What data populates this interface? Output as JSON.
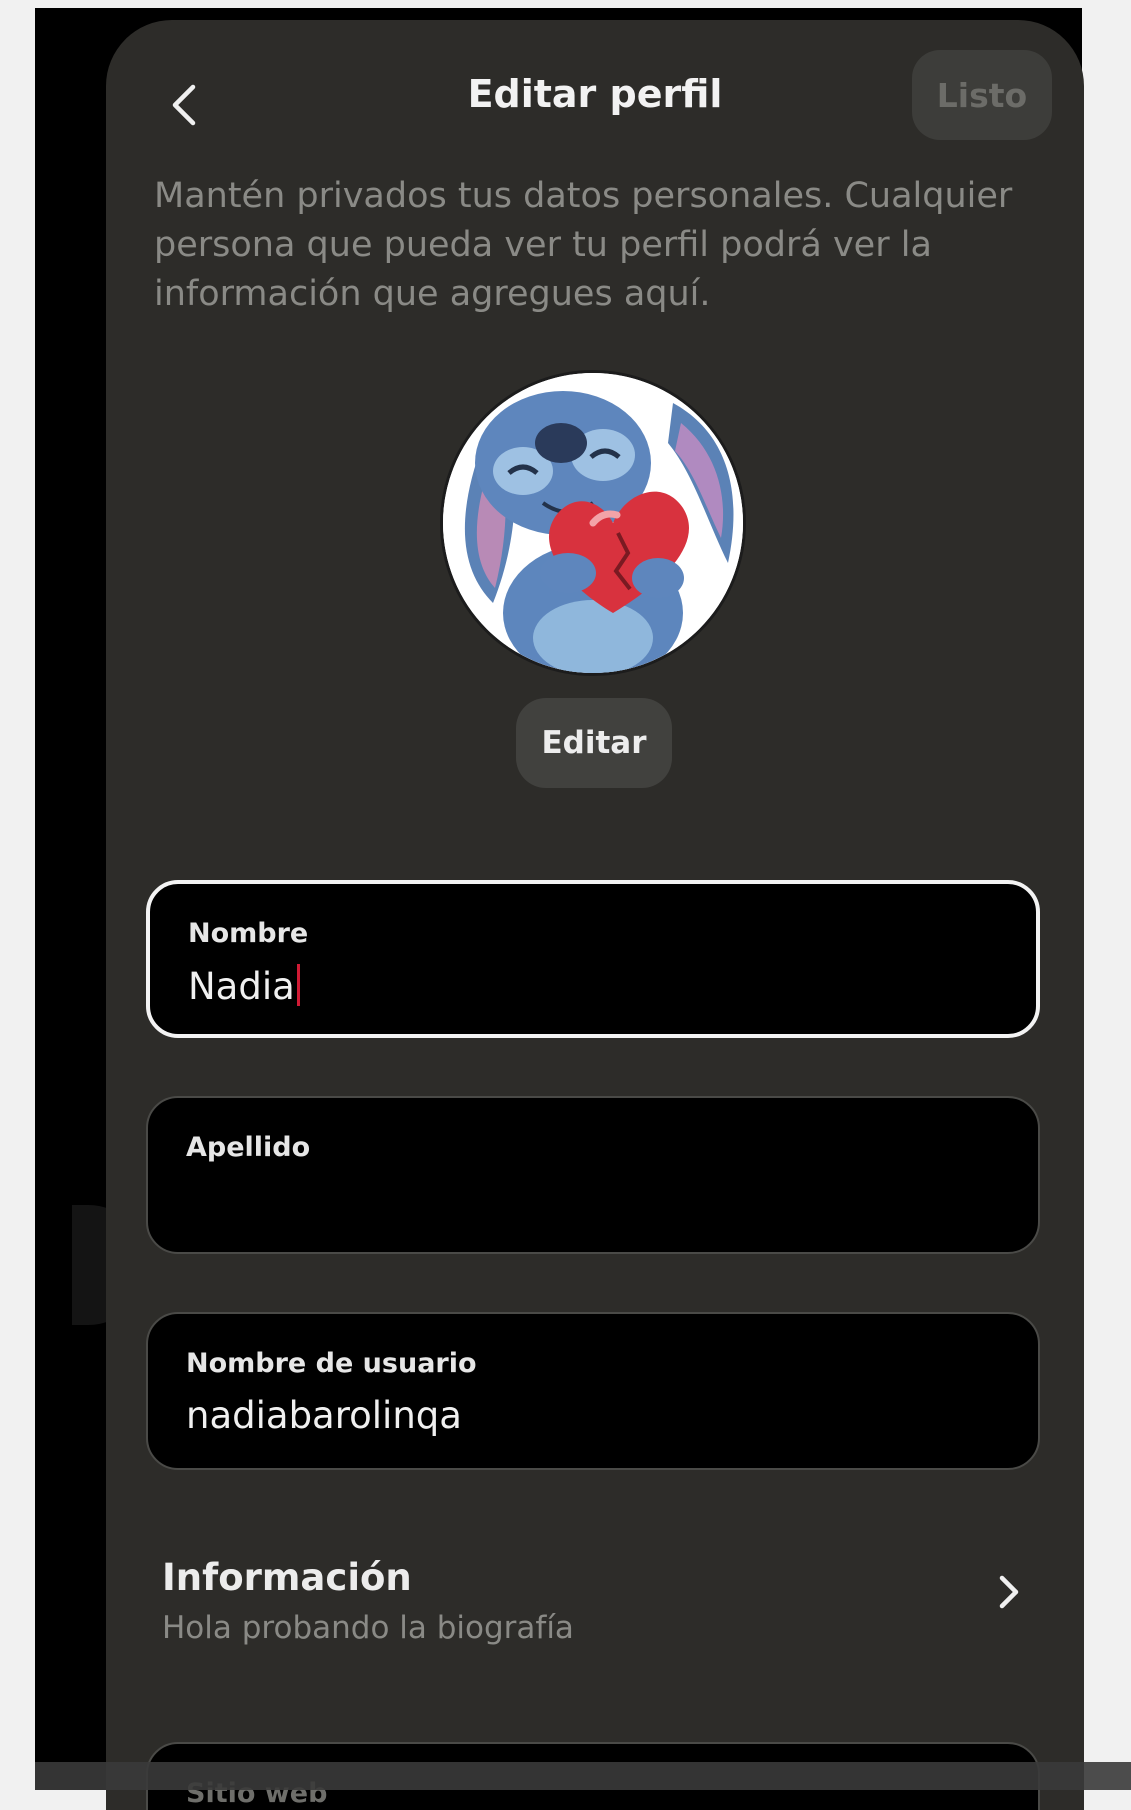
{
  "header": {
    "back_icon": "chevron-left-icon",
    "title": "Editar perfil",
    "done_label": "Listo"
  },
  "notice": "Mantén privados tus datos personales. Cualquier persona que pueda ver tu perfil podrá ver la información que agregues aquí.",
  "profile_photo": {
    "edit_label": "Editar"
  },
  "fields": {
    "first_name": {
      "label": "Nombre",
      "value": "Nadia"
    },
    "last_name": {
      "label": "Apellido",
      "value": ""
    },
    "username": {
      "label": "Nombre de usuario",
      "value": "nadiabarolinqa"
    },
    "website": {
      "label": "Sitio web",
      "value": ""
    }
  },
  "info": {
    "title": "Información",
    "subtitle": "Hola probando la biografía",
    "chevron_icon": "chevron-right-icon"
  },
  "colors": {
    "sheet_background": "#2d2c29",
    "field_background": "#000000",
    "caret": "#d01b35"
  }
}
